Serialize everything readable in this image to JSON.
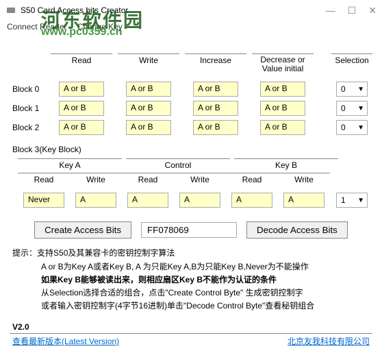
{
  "window": {
    "title": "S50 Card Access bits Creator"
  },
  "menu": {
    "connect": "Connect Reader",
    "changekey": "Change Key"
  },
  "watermark": {
    "line1": "河东软件园",
    "line2": "www.pc0359.cn"
  },
  "headers": {
    "read": "Read",
    "write": "Write",
    "increase": "Increase",
    "decrease": "Decrease or Value initial",
    "selection": "Selection"
  },
  "rows": [
    {
      "label": "Block 0",
      "read": "A or B",
      "write": "A or B",
      "increase": "A or B",
      "decrease": "A or B",
      "sel": "0"
    },
    {
      "label": "Block 1",
      "read": "A or B",
      "write": "A or B",
      "increase": "A or B",
      "decrease": "A or B",
      "sel": "0"
    },
    {
      "label": "Block 2",
      "read": "A or B",
      "write": "A or B",
      "increase": "A or B",
      "decrease": "A or B",
      "sel": "0"
    }
  ],
  "block3": {
    "title": "Block 3(Key Block)",
    "groups": {
      "keya": "Key A",
      "control": "Control",
      "keyb": "Key B"
    },
    "sub": {
      "read": "Read",
      "write": "Write"
    },
    "values": {
      "keya_read": "Never",
      "keya_write": "A",
      "control_read": "A",
      "control_write": "A",
      "keyb_read": "A",
      "keyb_write": "A"
    },
    "sel": "1"
  },
  "buttons": {
    "create": "Create Access Bits",
    "decode": "Decode Access Bits"
  },
  "hex": "FF078069",
  "tips": {
    "prefix": "提示：",
    "line1": "支持S50及其兼容卡的密钥控制字算法",
    "line2": "A or B为Key A或者Key B, A 为只能Key A,B为只能Key B,Never为不能操作",
    "line3": "如果Key B能够被读出来，则相应扇区Key B不能作为认证的条件",
    "line4": "从Selection选择合适的组合，点击\"Create Control Byte\" 生成密钥控制字",
    "line5": "或者输入密钥控制字(4字节16进制)单击\"Decode Control Byte\"查看秘钥组合"
  },
  "footer": {
    "version": "V2.0",
    "latest": "查看最新版本(Latest Version)",
    "company": "北京友我科技有限公司"
  }
}
